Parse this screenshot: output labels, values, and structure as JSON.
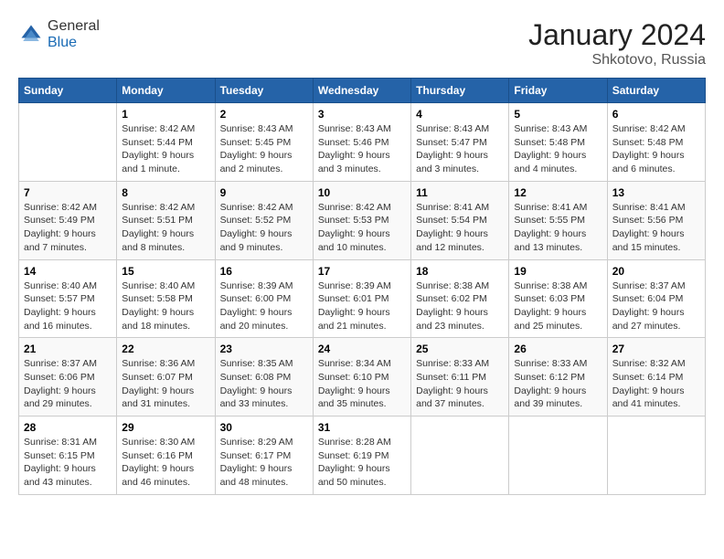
{
  "header": {
    "logo_general": "General",
    "logo_blue": "Blue",
    "month_year": "January 2024",
    "location": "Shkotovo, Russia"
  },
  "weekdays": [
    "Sunday",
    "Monday",
    "Tuesday",
    "Wednesday",
    "Thursday",
    "Friday",
    "Saturday"
  ],
  "weeks": [
    [
      {
        "day": "",
        "sunrise": "",
        "sunset": "",
        "daylight": ""
      },
      {
        "day": "1",
        "sunrise": "Sunrise: 8:42 AM",
        "sunset": "Sunset: 5:44 PM",
        "daylight": "Daylight: 9 hours and 1 minute."
      },
      {
        "day": "2",
        "sunrise": "Sunrise: 8:43 AM",
        "sunset": "Sunset: 5:45 PM",
        "daylight": "Daylight: 9 hours and 2 minutes."
      },
      {
        "day": "3",
        "sunrise": "Sunrise: 8:43 AM",
        "sunset": "Sunset: 5:46 PM",
        "daylight": "Daylight: 9 hours and 3 minutes."
      },
      {
        "day": "4",
        "sunrise": "Sunrise: 8:43 AM",
        "sunset": "Sunset: 5:47 PM",
        "daylight": "Daylight: 9 hours and 3 minutes."
      },
      {
        "day": "5",
        "sunrise": "Sunrise: 8:43 AM",
        "sunset": "Sunset: 5:48 PM",
        "daylight": "Daylight: 9 hours and 4 minutes."
      },
      {
        "day": "6",
        "sunrise": "Sunrise: 8:42 AM",
        "sunset": "Sunset: 5:48 PM",
        "daylight": "Daylight: 9 hours and 6 minutes."
      }
    ],
    [
      {
        "day": "7",
        "sunrise": "Sunrise: 8:42 AM",
        "sunset": "Sunset: 5:49 PM",
        "daylight": "Daylight: 9 hours and 7 minutes."
      },
      {
        "day": "8",
        "sunrise": "Sunrise: 8:42 AM",
        "sunset": "Sunset: 5:51 PM",
        "daylight": "Daylight: 9 hours and 8 minutes."
      },
      {
        "day": "9",
        "sunrise": "Sunrise: 8:42 AM",
        "sunset": "Sunset: 5:52 PM",
        "daylight": "Daylight: 9 hours and 9 minutes."
      },
      {
        "day": "10",
        "sunrise": "Sunrise: 8:42 AM",
        "sunset": "Sunset: 5:53 PM",
        "daylight": "Daylight: 9 hours and 10 minutes."
      },
      {
        "day": "11",
        "sunrise": "Sunrise: 8:41 AM",
        "sunset": "Sunset: 5:54 PM",
        "daylight": "Daylight: 9 hours and 12 minutes."
      },
      {
        "day": "12",
        "sunrise": "Sunrise: 8:41 AM",
        "sunset": "Sunset: 5:55 PM",
        "daylight": "Daylight: 9 hours and 13 minutes."
      },
      {
        "day": "13",
        "sunrise": "Sunrise: 8:41 AM",
        "sunset": "Sunset: 5:56 PM",
        "daylight": "Daylight: 9 hours and 15 minutes."
      }
    ],
    [
      {
        "day": "14",
        "sunrise": "Sunrise: 8:40 AM",
        "sunset": "Sunset: 5:57 PM",
        "daylight": "Daylight: 9 hours and 16 minutes."
      },
      {
        "day": "15",
        "sunrise": "Sunrise: 8:40 AM",
        "sunset": "Sunset: 5:58 PM",
        "daylight": "Daylight: 9 hours and 18 minutes."
      },
      {
        "day": "16",
        "sunrise": "Sunrise: 8:39 AM",
        "sunset": "Sunset: 6:00 PM",
        "daylight": "Daylight: 9 hours and 20 minutes."
      },
      {
        "day": "17",
        "sunrise": "Sunrise: 8:39 AM",
        "sunset": "Sunset: 6:01 PM",
        "daylight": "Daylight: 9 hours and 21 minutes."
      },
      {
        "day": "18",
        "sunrise": "Sunrise: 8:38 AM",
        "sunset": "Sunset: 6:02 PM",
        "daylight": "Daylight: 9 hours and 23 minutes."
      },
      {
        "day": "19",
        "sunrise": "Sunrise: 8:38 AM",
        "sunset": "Sunset: 6:03 PM",
        "daylight": "Daylight: 9 hours and 25 minutes."
      },
      {
        "day": "20",
        "sunrise": "Sunrise: 8:37 AM",
        "sunset": "Sunset: 6:04 PM",
        "daylight": "Daylight: 9 hours and 27 minutes."
      }
    ],
    [
      {
        "day": "21",
        "sunrise": "Sunrise: 8:37 AM",
        "sunset": "Sunset: 6:06 PM",
        "daylight": "Daylight: 9 hours and 29 minutes."
      },
      {
        "day": "22",
        "sunrise": "Sunrise: 8:36 AM",
        "sunset": "Sunset: 6:07 PM",
        "daylight": "Daylight: 9 hours and 31 minutes."
      },
      {
        "day": "23",
        "sunrise": "Sunrise: 8:35 AM",
        "sunset": "Sunset: 6:08 PM",
        "daylight": "Daylight: 9 hours and 33 minutes."
      },
      {
        "day": "24",
        "sunrise": "Sunrise: 8:34 AM",
        "sunset": "Sunset: 6:10 PM",
        "daylight": "Daylight: 9 hours and 35 minutes."
      },
      {
        "day": "25",
        "sunrise": "Sunrise: 8:33 AM",
        "sunset": "Sunset: 6:11 PM",
        "daylight": "Daylight: 9 hours and 37 minutes."
      },
      {
        "day": "26",
        "sunrise": "Sunrise: 8:33 AM",
        "sunset": "Sunset: 6:12 PM",
        "daylight": "Daylight: 9 hours and 39 minutes."
      },
      {
        "day": "27",
        "sunrise": "Sunrise: 8:32 AM",
        "sunset": "Sunset: 6:14 PM",
        "daylight": "Daylight: 9 hours and 41 minutes."
      }
    ],
    [
      {
        "day": "28",
        "sunrise": "Sunrise: 8:31 AM",
        "sunset": "Sunset: 6:15 PM",
        "daylight": "Daylight: 9 hours and 43 minutes."
      },
      {
        "day": "29",
        "sunrise": "Sunrise: 8:30 AM",
        "sunset": "Sunset: 6:16 PM",
        "daylight": "Daylight: 9 hours and 46 minutes."
      },
      {
        "day": "30",
        "sunrise": "Sunrise: 8:29 AM",
        "sunset": "Sunset: 6:17 PM",
        "daylight": "Daylight: 9 hours and 48 minutes."
      },
      {
        "day": "31",
        "sunrise": "Sunrise: 8:28 AM",
        "sunset": "Sunset: 6:19 PM",
        "daylight": "Daylight: 9 hours and 50 minutes."
      },
      {
        "day": "",
        "sunrise": "",
        "sunset": "",
        "daylight": ""
      },
      {
        "day": "",
        "sunrise": "",
        "sunset": "",
        "daylight": ""
      },
      {
        "day": "",
        "sunrise": "",
        "sunset": "",
        "daylight": ""
      }
    ]
  ]
}
